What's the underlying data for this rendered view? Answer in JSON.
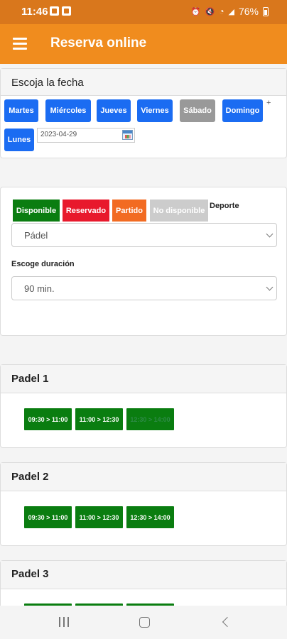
{
  "status_bar": {
    "time": "11:46",
    "battery": "76%"
  },
  "app_bar": {
    "title": "Reserva online"
  },
  "date_card": {
    "title": "Escoja la fecha",
    "days": [
      "Martes",
      "Miércoles",
      "Jueves",
      "Viernes",
      "Sábado",
      "Domingo",
      "Lunes"
    ],
    "plus": "+",
    "date_value": "2023-04-29"
  },
  "filter_card": {
    "legend": [
      "Disponible",
      "Reservado",
      "Partido",
      "No disponible"
    ],
    "deporte_label": "Deporte",
    "sport_value": "Pádel",
    "duration_label": "Escoge duración",
    "duration_value": "90 min."
  },
  "courts": [
    {
      "name": "Padel 1",
      "slots": [
        "09:30 > 11:00",
        "11:00 > 12:30",
        "12:30 > 14:00"
      ]
    },
    {
      "name": "Padel 2",
      "slots": [
        "09:30 > 11:00",
        "11:00 > 12:30",
        "12:30 > 14:00"
      ]
    },
    {
      "name": "Padel 3"
    }
  ],
  "colors": {
    "status_bar": "#d9771c",
    "app_bar": "#f08c1e",
    "day_button": "#1b6cf2",
    "day_button_disabled": "#999999",
    "disponible": "#0a7d10",
    "reservado": "#e8192c",
    "partido": "#f26b22",
    "no_disponible": "#cccccc"
  },
  "icons": [
    "gallery-icon",
    "app-icon",
    "alarm-icon",
    "mute-icon",
    "wifi-icon",
    "signal-icon",
    "battery-icon",
    "menu-icon",
    "calendar-icon",
    "chevron-down-icon",
    "recents-icon",
    "home-icon",
    "back-icon"
  ]
}
